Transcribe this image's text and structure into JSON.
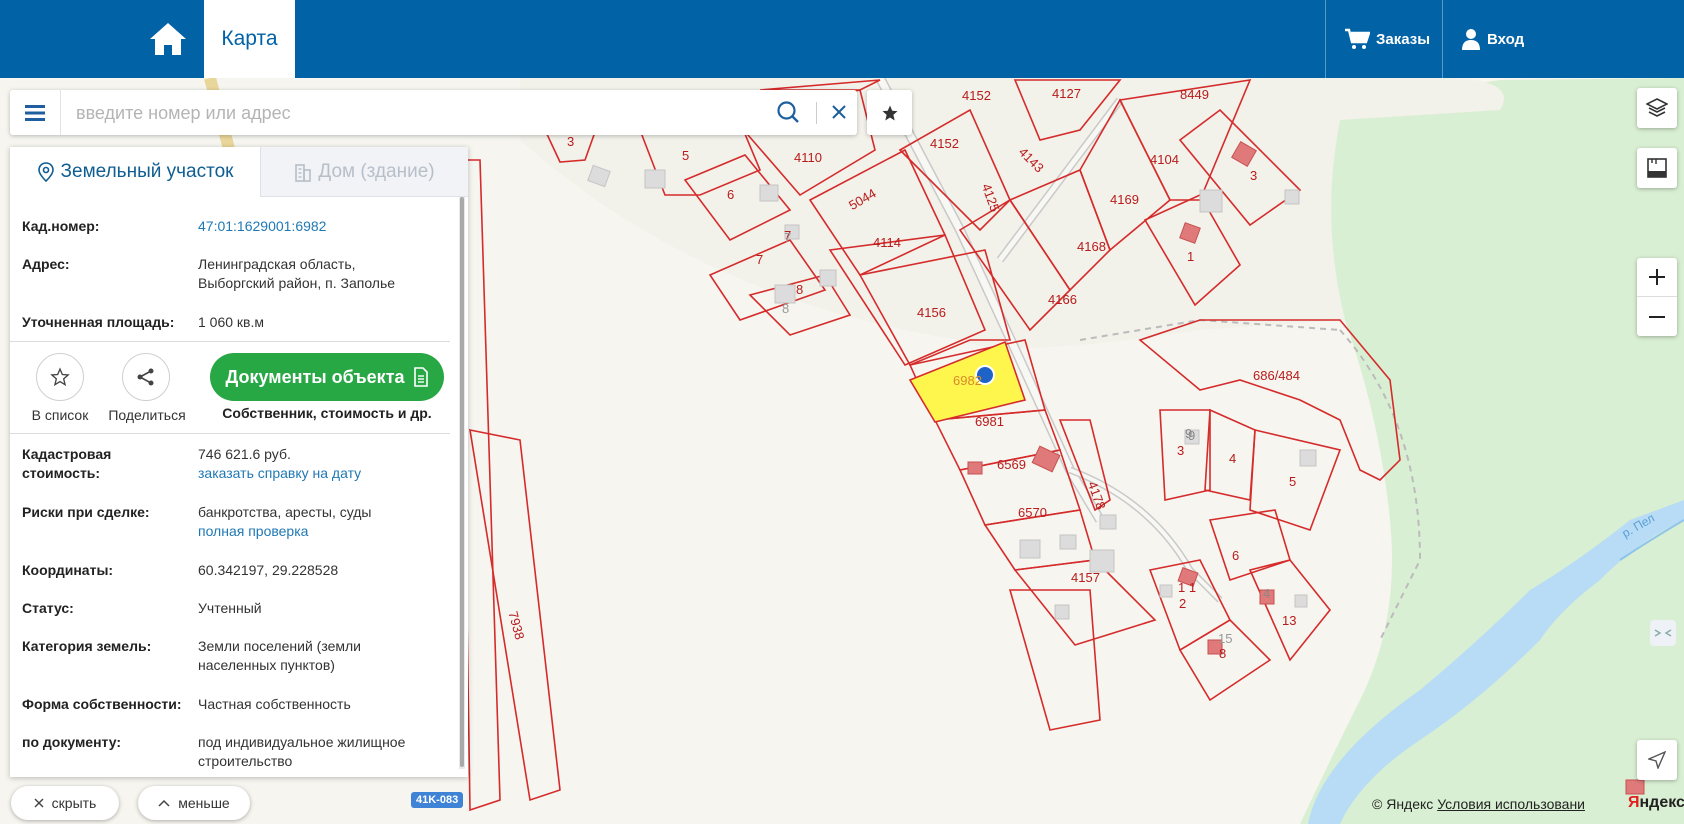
{
  "header": {
    "tab_map": "Карта",
    "orders_label": "Заказы",
    "login_label": "Вход"
  },
  "search": {
    "placeholder": "введите номер или адрес"
  },
  "panel": {
    "tab_land": "Земельный участок",
    "tab_house": "Дом (здание)",
    "cad_number_label": "Кад.номер:",
    "cad_number_value": "47:01:1629001:6982",
    "address_label": "Адрес:",
    "address_line1": "Ленинградская область,",
    "address_line2": "Выборгский район, п. Заполье",
    "area_label": "Уточненная площадь:",
    "area_value": "1 060 кв.м",
    "add_to_list_label": "В список",
    "share_label": "Поделиться",
    "documents_button": "Документы объекта",
    "documents_sub": "Собственник, стоимость и др.",
    "cad_cost_label_1": "Кадастровая",
    "cad_cost_label_2": "стоимость:",
    "cad_cost_value": "746 621.6 руб.",
    "cad_cost_link": "заказать справку на дату",
    "risks_label": "Риски при сделке:",
    "risks_value": "банкротства, аресты, суды",
    "risks_link": "полная проверка",
    "coords_label": "Координаты:",
    "coords_value": "60.342197, 29.228528",
    "status_label": "Статус:",
    "status_value": "Учтенный",
    "category_label": "Категория земель:",
    "category_line1": "Земли поселений (земли",
    "category_line2": "населенных пунктов)",
    "ownership_label": "Форма собственности:",
    "ownership_value": "Частная собственность",
    "by_doc_label": "по документу:",
    "by_doc_line1": "под индивидуальное жилищное",
    "by_doc_line2": "строительство"
  },
  "bottom": {
    "hide_label": "скрыть",
    "less_label": "меньше"
  },
  "map": {
    "road_badge": "41K-083",
    "attribution_prefix": "© Яндекс",
    "attribution_terms": "Условия использовани",
    "yandex_logo_ya": "Я",
    "yandex_logo_rest": "ндекс",
    "river_label": "р. Пел",
    "parcel_labels": [
      "4152",
      "4127",
      "8449",
      "3",
      "5",
      "4110",
      "4152",
      "4143",
      "4104",
      "6",
      "5044",
      "4125",
      "4169",
      "3",
      "7",
      "4114",
      "4168",
      "1",
      "7",
      "8",
      "4156",
      "4166",
      "8",
      "686/484",
      "6982",
      "6981",
      "9",
      "3",
      "4",
      "6569",
      "5",
      "4178",
      "6570",
      "6",
      "4157",
      "1 1",
      "2",
      "4",
      "13",
      "15",
      "8",
      "7938",
      "9",
      "7"
    ],
    "colors": {
      "parcel_border": "#d52b2b",
      "selected_fill": "#fff64d",
      "water": "#b8dcf5",
      "forest": "#d9efd3",
      "header": "#0162a6",
      "green_button": "#28a745"
    }
  }
}
